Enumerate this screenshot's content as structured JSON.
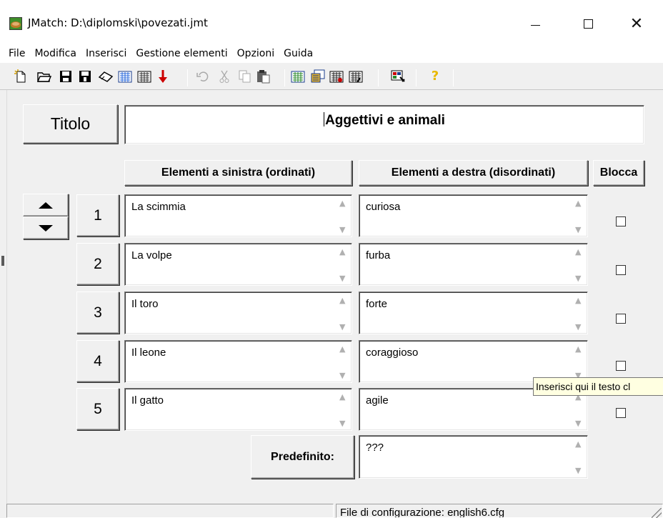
{
  "window": {
    "title": "JMatch: D:\\diplomski\\povezati.jmt",
    "close_glyph": "✕"
  },
  "menu": [
    "File",
    "Modifica",
    "Inserisci",
    "Gestione elementi",
    "Opzioni",
    "Guida"
  ],
  "toolbar": {
    "icons": [
      "new-file-icon",
      "open-folder-icon",
      "save-icon",
      "save-as-icon",
      "clear-icon",
      "export-web-page-icon",
      "export-web-page-dhtml-icon",
      "move-down-icon",
      "undo-icon",
      "cut-icon",
      "copy-icon",
      "paste-icon",
      "insert-picture-icon",
      "insert-link-icon",
      "insert-media-icon",
      "insert-text-icon",
      "configuration-icon",
      "help-icon"
    ],
    "help_glyph": "?"
  },
  "exercise": {
    "title_button": "Titolo",
    "title_value": "Aggettivi e animali"
  },
  "columns": {
    "left": "Elementi a sinistra (ordinati)",
    "right": "Elementi a destra (disordinati)",
    "lock": "Blocca"
  },
  "rows": [
    {
      "num": "1",
      "left": "La scimmia",
      "right": "curiosa",
      "locked": false
    },
    {
      "num": "2",
      "left": "La volpe",
      "right": "furba",
      "locked": false
    },
    {
      "num": "3",
      "left": "Il toro",
      "right": "forte",
      "locked": false
    },
    {
      "num": "4",
      "left": "Il leone",
      "right": "coraggioso",
      "locked": false
    },
    {
      "num": "5",
      "left": "Il gatto",
      "right": "agile",
      "locked": false
    }
  ],
  "default": {
    "label": "Predefinito:",
    "value": "???"
  },
  "tooltip": "Inserisci qui il testo cl",
  "status": {
    "config": "File di configurazione: english6.cfg"
  },
  "colors": {
    "help_icon": "#e8b800",
    "tooltip_bg": "#ffffe1",
    "save_icon": "#000000",
    "arrow_red": "#cc0000"
  }
}
